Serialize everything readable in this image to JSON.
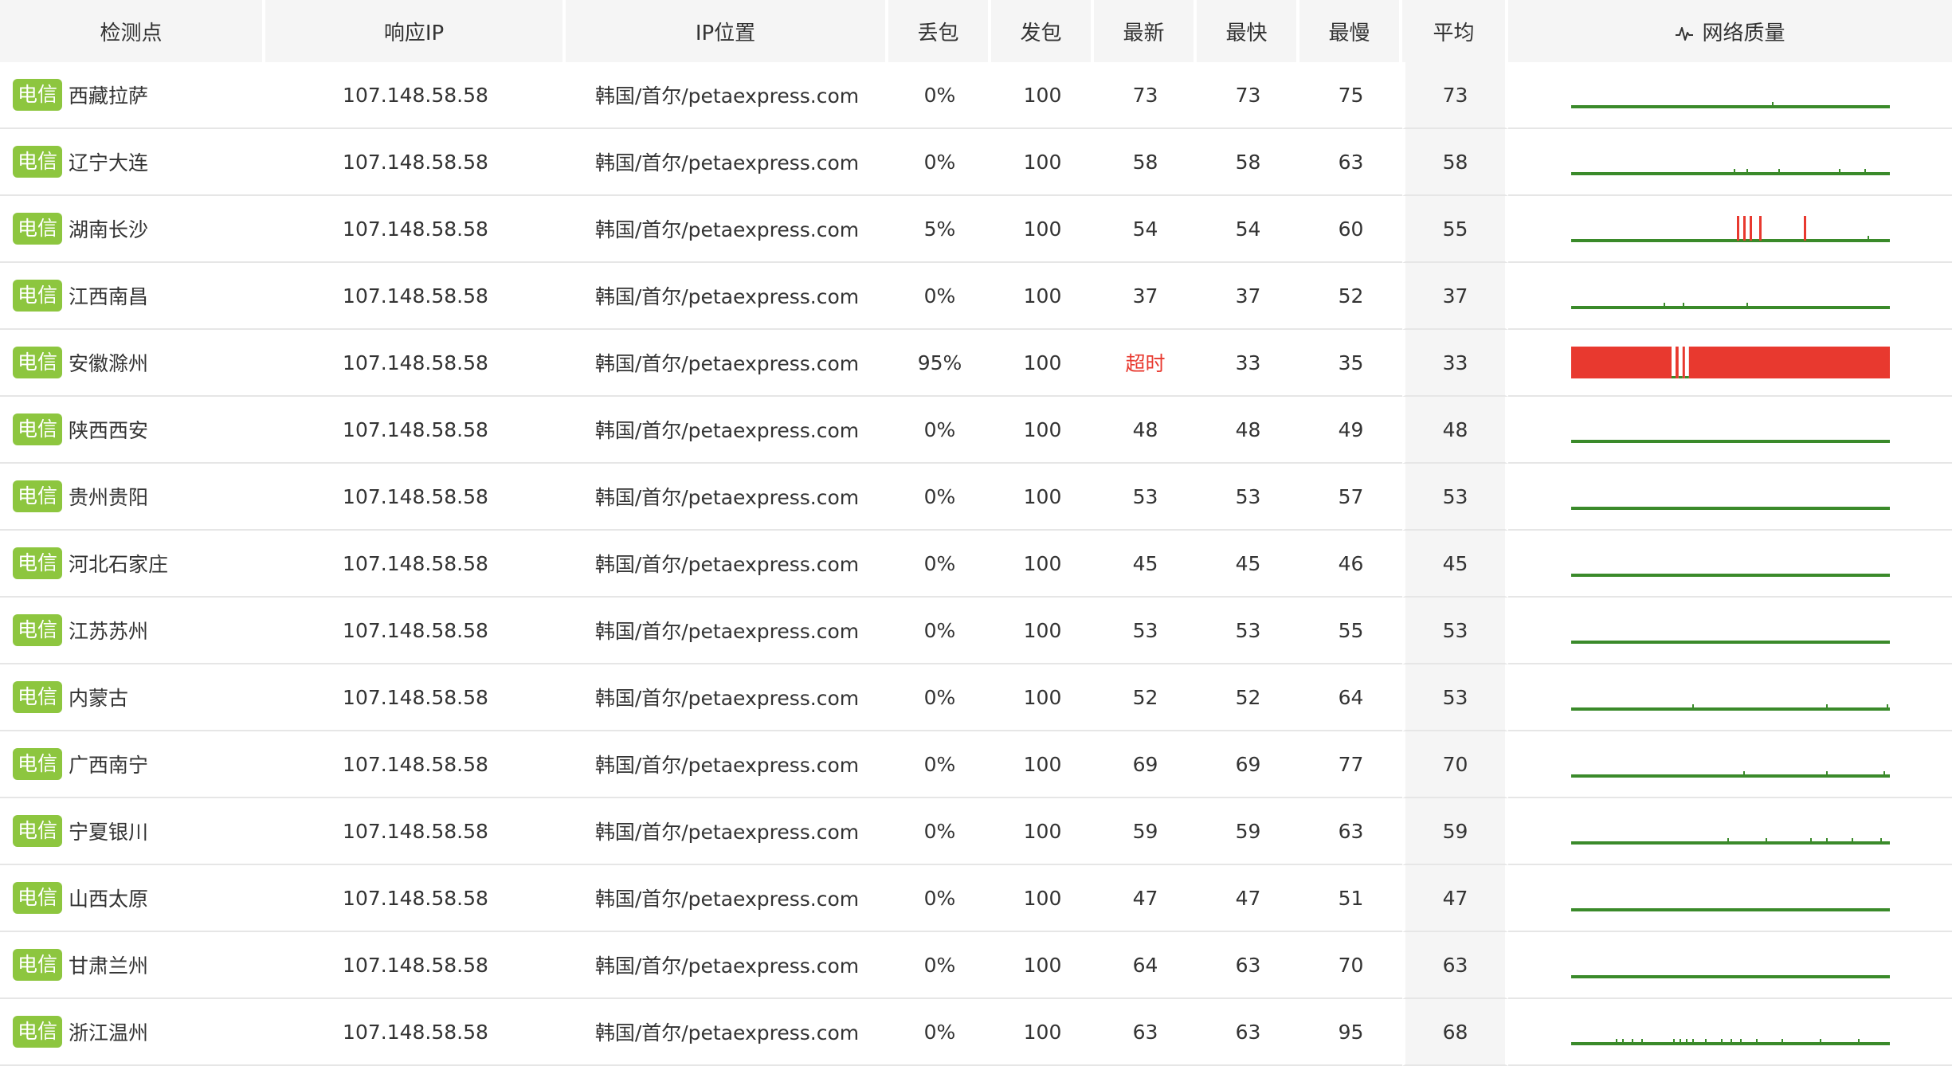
{
  "header": {
    "site": "检测点",
    "ip": "响应IP",
    "location": "IP位置",
    "loss": "丢包",
    "sent": "发包",
    "latest": "最新",
    "fastest": "最快",
    "slowest": "最慢",
    "average": "平均",
    "quality": "网络质量",
    "quality_icon": "pulse-icon"
  },
  "colors": {
    "isp_badge": "#8dc63f",
    "good": "#3a8a2a",
    "lost": "#e8392f",
    "timeout_text": "#e8392f"
  },
  "rows": [
    {
      "isp": "电信",
      "site": "西藏拉萨",
      "ip": "107.148.58.58",
      "location": "韩国/首尔/petaexpress.com",
      "loss": "0%",
      "sent": "100",
      "latest": "73",
      "fastest": "73",
      "slowest": "75",
      "average": "73",
      "quality": {
        "loss_fraction": 0,
        "loss_marks": [],
        "ok_gaps": [],
        "jitter_marks": [
          0.63
        ]
      }
    },
    {
      "isp": "电信",
      "site": "辽宁大连",
      "ip": "107.148.58.58",
      "location": "韩国/首尔/petaexpress.com",
      "loss": "0%",
      "sent": "100",
      "latest": "58",
      "fastest": "58",
      "slowest": "63",
      "average": "58",
      "quality": {
        "loss_fraction": 0,
        "loss_marks": [],
        "ok_gaps": [],
        "jitter_marks": [
          0.51,
          0.55,
          0.65,
          0.84,
          0.92
        ]
      }
    },
    {
      "isp": "电信",
      "site": "湖南长沙",
      "ip": "107.148.58.58",
      "location": "韩国/首尔/petaexpress.com",
      "loss": "5%",
      "sent": "100",
      "latest": "54",
      "fastest": "54",
      "slowest": "60",
      "average": "55",
      "quality": {
        "loss_fraction": 0,
        "loss_marks": [
          0.52,
          0.54,
          0.56,
          0.59,
          0.73
        ],
        "ok_gaps": [],
        "jitter_marks": [
          0.93
        ]
      }
    },
    {
      "isp": "电信",
      "site": "江西南昌",
      "ip": "107.148.58.58",
      "location": "韩国/首尔/petaexpress.com",
      "loss": "0%",
      "sent": "100",
      "latest": "37",
      "fastest": "37",
      "slowest": "52",
      "average": "37",
      "quality": {
        "loss_fraction": 0,
        "loss_marks": [],
        "ok_gaps": [],
        "jitter_marks": [
          0.29,
          0.35,
          0.55
        ]
      }
    },
    {
      "isp": "电信",
      "site": "安徽滁州",
      "ip": "107.148.58.58",
      "location": "韩国/首尔/petaexpress.com",
      "loss": "95%",
      "sent": "100",
      "latest": "超时",
      "latest_timeout": true,
      "fastest": "33",
      "slowest": "35",
      "average": "33",
      "quality": {
        "loss_fraction": 0.95,
        "loss_marks": [],
        "ok_gaps": [
          0.315,
          0.337,
          0.357
        ],
        "jitter_marks": []
      }
    },
    {
      "isp": "电信",
      "site": "陕西西安",
      "ip": "107.148.58.58",
      "location": "韩国/首尔/petaexpress.com",
      "loss": "0%",
      "sent": "100",
      "latest": "48",
      "fastest": "48",
      "slowest": "49",
      "average": "48",
      "quality": {
        "loss_fraction": 0,
        "loss_marks": [],
        "ok_gaps": [],
        "jitter_marks": []
      }
    },
    {
      "isp": "电信",
      "site": "贵州贵阳",
      "ip": "107.148.58.58",
      "location": "韩国/首尔/petaexpress.com",
      "loss": "0%",
      "sent": "100",
      "latest": "53",
      "fastest": "53",
      "slowest": "57",
      "average": "53",
      "quality": {
        "loss_fraction": 0,
        "loss_marks": [],
        "ok_gaps": [],
        "jitter_marks": []
      }
    },
    {
      "isp": "电信",
      "site": "河北石家庄",
      "ip": "107.148.58.58",
      "location": "韩国/首尔/petaexpress.com",
      "loss": "0%",
      "sent": "100",
      "latest": "45",
      "fastest": "45",
      "slowest": "46",
      "average": "45",
      "quality": {
        "loss_fraction": 0,
        "loss_marks": [],
        "ok_gaps": [],
        "jitter_marks": []
      }
    },
    {
      "isp": "电信",
      "site": "江苏苏州",
      "ip": "107.148.58.58",
      "location": "韩国/首尔/petaexpress.com",
      "loss": "0%",
      "sent": "100",
      "latest": "53",
      "fastest": "53",
      "slowest": "55",
      "average": "53",
      "quality": {
        "loss_fraction": 0,
        "loss_marks": [],
        "ok_gaps": [],
        "jitter_marks": []
      }
    },
    {
      "isp": "电信",
      "site": "内蒙古",
      "ip": "107.148.58.58",
      "location": "韩国/首尔/petaexpress.com",
      "loss": "0%",
      "sent": "100",
      "latest": "52",
      "fastest": "52",
      "slowest": "64",
      "average": "53",
      "quality": {
        "loss_fraction": 0,
        "loss_marks": [],
        "ok_gaps": [],
        "jitter_marks": [
          0.38,
          0.8,
          0.99
        ]
      }
    },
    {
      "isp": "电信",
      "site": "广西南宁",
      "ip": "107.148.58.58",
      "location": "韩国/首尔/petaexpress.com",
      "loss": "0%",
      "sent": "100",
      "latest": "69",
      "fastest": "69",
      "slowest": "77",
      "average": "70",
      "quality": {
        "loss_fraction": 0,
        "loss_marks": [],
        "ok_gaps": [],
        "jitter_marks": [
          0.54,
          0.8,
          0.98
        ]
      }
    },
    {
      "isp": "电信",
      "site": "宁夏银川",
      "ip": "107.148.58.58",
      "location": "韩国/首尔/petaexpress.com",
      "loss": "0%",
      "sent": "100",
      "latest": "59",
      "fastest": "59",
      "slowest": "63",
      "average": "59",
      "quality": {
        "loss_fraction": 0,
        "loss_marks": [],
        "ok_gaps": [],
        "jitter_marks": [
          0.49,
          0.61,
          0.75,
          0.8,
          0.88,
          0.97
        ]
      }
    },
    {
      "isp": "电信",
      "site": "山西太原",
      "ip": "107.148.58.58",
      "location": "韩国/首尔/petaexpress.com",
      "loss": "0%",
      "sent": "100",
      "latest": "47",
      "fastest": "47",
      "slowest": "51",
      "average": "47",
      "quality": {
        "loss_fraction": 0,
        "loss_marks": [],
        "ok_gaps": [],
        "jitter_marks": []
      }
    },
    {
      "isp": "电信",
      "site": "甘肃兰州",
      "ip": "107.148.58.58",
      "location": "韩国/首尔/petaexpress.com",
      "loss": "0%",
      "sent": "100",
      "latest": "64",
      "fastest": "63",
      "slowest": "70",
      "average": "63",
      "quality": {
        "loss_fraction": 0,
        "loss_marks": [],
        "ok_gaps": [],
        "jitter_marks": []
      }
    },
    {
      "isp": "电信",
      "site": "浙江温州",
      "ip": "107.148.58.58",
      "location": "韩国/首尔/petaexpress.com",
      "loss": "0%",
      "sent": "100",
      "latest": "63",
      "fastest": "63",
      "slowest": "95",
      "average": "68",
      "quality": {
        "loss_fraction": 0,
        "loss_marks": [],
        "ok_gaps": [],
        "jitter_marks": [
          0.14,
          0.16,
          0.19,
          0.22,
          0.32,
          0.34,
          0.36,
          0.38,
          0.42,
          0.47,
          0.5,
          0.53,
          0.58,
          0.66,
          0.78,
          0.9
        ]
      }
    }
  ]
}
